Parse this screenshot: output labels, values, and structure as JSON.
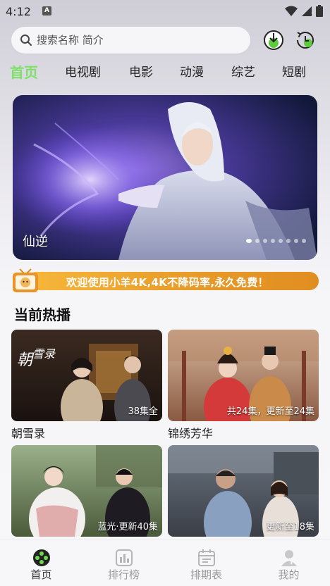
{
  "status_bar": {
    "time": "4:12",
    "notification_icon": "A"
  },
  "search": {
    "placeholder": "搜索名称 简介"
  },
  "tabs": [
    {
      "label": "首页",
      "active": true
    },
    {
      "label": "电视剧"
    },
    {
      "label": "电影"
    },
    {
      "label": "动漫"
    },
    {
      "label": "综艺"
    },
    {
      "label": "短剧"
    }
  ],
  "banner": {
    "title": "仙逆",
    "slide_count": 8,
    "active_slide": 0
  },
  "notice": {
    "text": "欢迎使用小羊4K,4K不降码率,永久免费！"
  },
  "section": {
    "title": "当前热播"
  },
  "cards": [
    {
      "name": "朝雪录",
      "badge": "38集全"
    },
    {
      "name": "锦绣芳华",
      "badge": "共24集，更新至24集"
    },
    {
      "name": "",
      "badge": "蓝光·更新40集"
    },
    {
      "name": "",
      "badge": "更新至18集"
    }
  ],
  "bottom_nav": [
    {
      "label": "首页",
      "icon": "home-icon",
      "active": true
    },
    {
      "label": "排行榜",
      "icon": "chart-icon"
    },
    {
      "label": "排期表",
      "icon": "calendar-icon"
    },
    {
      "label": "我的",
      "icon": "profile-icon"
    }
  ],
  "colors": {
    "accent": "#7ee06a",
    "notice": "#e79a28"
  }
}
